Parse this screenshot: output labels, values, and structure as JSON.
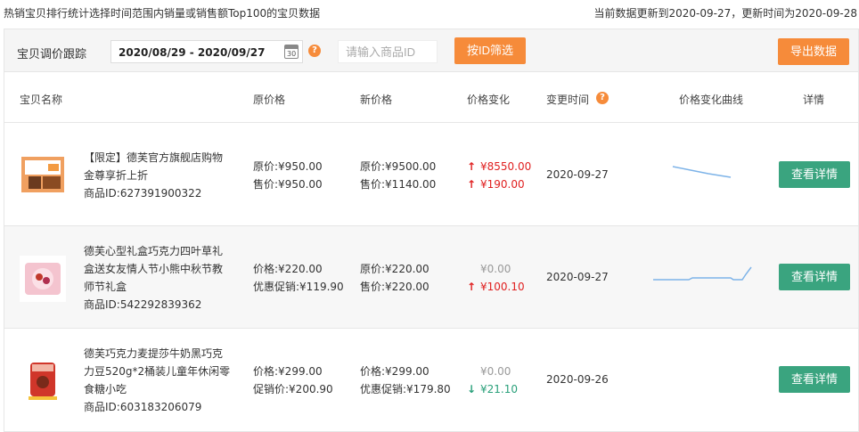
{
  "header": {
    "description": "热销宝贝排行统计选择时间范围内销量或销售额Top100的宝贝数据",
    "update_info": "当前数据更新到2020-09-27，更新时间为2020-09-28"
  },
  "filter": {
    "title": "宝贝调价跟踪",
    "date_range": "2020/08/29 - 2020/09/27",
    "calendar_day": "30",
    "help": "?",
    "id_placeholder": "请输入商品ID",
    "filter_button": "按ID筛选",
    "export_button": "导出数据"
  },
  "table": {
    "columns": {
      "name": "宝贝名称",
      "orig_price": "原价格",
      "new_price": "新价格",
      "change": "价格变化",
      "change_time": "变更时间",
      "curve": "价格变化曲线",
      "detail": "详情"
    },
    "help": "?",
    "rows": [
      {
        "image": "product-thumbnail",
        "name": "【限定】德芙官方旗舰店购物金尊享折上折",
        "id_text": "商品ID:627391900322",
        "orig_line1": "原价:¥950.00",
        "orig_line2": "售价:¥950.00",
        "new_line1": "原价:¥9500.00",
        "new_line2": "售价:¥1140.00",
        "change1": {
          "dir": "up",
          "text": "¥8550.00"
        },
        "change2": {
          "dir": "up",
          "text": "¥190.00"
        },
        "time": "2020-09-27",
        "curve_values": [
          9,
          8,
          7,
          6,
          5,
          4
        ],
        "detail_button": "查看详情"
      },
      {
        "image": "product-thumbnail",
        "name": "德芙心型礼盒巧克力四叶草礼盒送女友情人节小熊中秋节教师节礼盒",
        "id_text": "商品ID:542292839362",
        "orig_line1": "价格:¥220.00",
        "orig_line2": "优惠促销:¥119.90",
        "new_line1": "原价:¥220.00",
        "new_line2": "售价:¥220.00",
        "change1": {
          "dir": "none",
          "text": "¥0.00"
        },
        "change2": {
          "dir": "up",
          "text": "¥100.10"
        },
        "time": "2020-09-27",
        "curve_values": [
          119.9,
          119.9,
          119.9,
          119.9,
          119.9,
          122,
          122,
          122,
          122,
          122,
          119.9,
          119.9,
          220
        ],
        "detail_button": "查看详情"
      },
      {
        "image": "product-thumbnail",
        "name": "德芙巧克力麦提莎牛奶黑巧克力豆520g*2桶装儿童年休闲零食糖小吃",
        "id_text": "商品ID:603183206079",
        "orig_line1": "价格:¥299.00",
        "orig_line2": "促销价:¥200.90",
        "new_line1": "价格:¥299.00",
        "new_line2": "优惠促销:¥179.80",
        "change1": {
          "dir": "none",
          "text": "¥0.00"
        },
        "change2": {
          "dir": "down",
          "text": "¥21.10"
        },
        "time": "2020-09-26",
        "curve_values": [],
        "detail_button": "查看详情"
      }
    ]
  },
  "colors": {
    "orange": "#f68b3a",
    "green": "#3aa47f",
    "up_red": "#e02020",
    "down_green": "#2aa07a",
    "curve_blue": "#7db3e8"
  }
}
